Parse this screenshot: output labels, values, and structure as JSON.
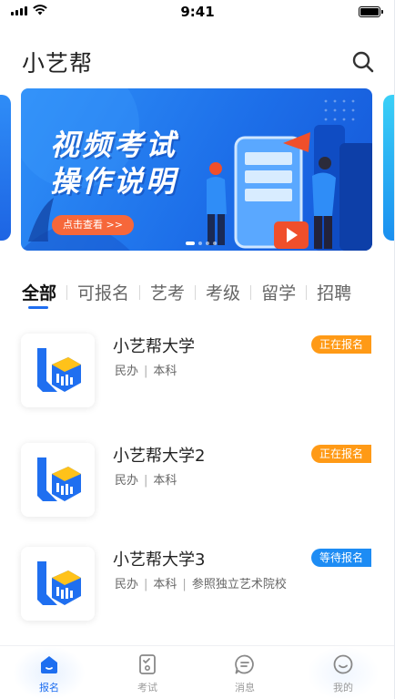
{
  "status_bar": {
    "time": "9:41"
  },
  "header": {
    "title": "小艺帮"
  },
  "banner": {
    "title_line1": "视频考试",
    "title_line2": "操作说明",
    "button_label": "点击查看 >>"
  },
  "tabs": [
    "全部",
    "可报名",
    "艺考",
    "考级",
    "留学",
    "招聘"
  ],
  "schools": [
    {
      "name": "小艺帮大学",
      "tags": [
        "民办",
        "本科"
      ],
      "status": "正在报名",
      "status_color": "#ff9a16"
    },
    {
      "name": "小艺帮大学2",
      "tags": [
        "民办",
        "本科"
      ],
      "status": "正在报名",
      "status_color": "#ff9a16"
    },
    {
      "name": "小艺帮大学3",
      "tags": [
        "民办",
        "本科",
        "参照独立艺术院校"
      ],
      "status": "等待报名",
      "status_color": "#1d8cf4"
    }
  ],
  "bottom_nav": [
    {
      "label": "报名",
      "icon": "home-icon",
      "active": true
    },
    {
      "label": "考试",
      "icon": "exam-icon",
      "active": false
    },
    {
      "label": "消息",
      "icon": "message-icon",
      "active": false
    },
    {
      "label": "我的",
      "icon": "profile-icon",
      "active": false
    }
  ],
  "colors": {
    "accent": "#1d6ef0",
    "badge_orange": "#ff9a16",
    "badge_blue": "#1d8cf4",
    "banner_button": "#f6673a"
  }
}
